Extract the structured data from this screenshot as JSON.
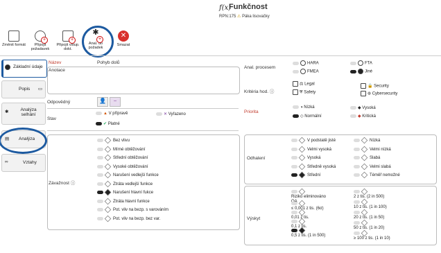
{
  "header": {
    "fx": "f(x)",
    "title": "Funkčnost",
    "rpn": "RPN:175",
    "warning": "Páka lisovačky"
  },
  "toolbar": [
    {
      "label": "Změnit formát",
      "icon": "format-icon"
    },
    {
      "label": "Připojit požadavek",
      "icon": "add-requirement-icon"
    },
    {
      "label": "Připojit vstup. dokt.",
      "icon": "add-document-icon"
    },
    {
      "label": "Anal. do požadek",
      "icon": "analysis-icon"
    },
    {
      "label": "Smazat",
      "icon": "delete-icon"
    }
  ],
  "sidebar": {
    "items": [
      {
        "label": "Základní údaje"
      },
      {
        "label": "Popis"
      },
      {
        "label": "Analýza selhání"
      },
      {
        "label": "Analýza"
      },
      {
        "label": "Vztahy"
      }
    ]
  },
  "form": {
    "name_label": "Název",
    "name_value": "Pohyb dolů",
    "annotation_label": "Anotace",
    "responsible_label": "Odpovědný",
    "state_label": "Stav",
    "state_options": [
      "V přípravě",
      "Vyřazeno",
      "Platné"
    ],
    "severity_label": "Závažnost",
    "severity_options": [
      "Bez vlivu",
      "Mírné obtěžování",
      "Střední obtěžování",
      "Vysoké obtěžování",
      "Narušení vedlejší funkce",
      "Ztráta vedlejší funkce",
      "Narušení hlavní fukce",
      "Ztráta hlavní funkce",
      "Pot. vliv na bezp. s varováním",
      "Pot. vliv na bezp. bez var."
    ]
  },
  "right": {
    "anal_proc_label": "Anal. procesem",
    "anal_proc_options": [
      "HARA",
      "FTA",
      "FMEA",
      "Jiné"
    ],
    "criteria_label": "Kritéria hod.",
    "criteria_options": [
      "Legal",
      "Security",
      "Safety",
      "Cybersecurity"
    ],
    "priority_label": "Priorita",
    "priority_options": [
      "Nízká",
      "Vysoká",
      "Normální",
      "Kritická"
    ],
    "detect_label": "Odhalení",
    "detect_options": [
      "V podstatě jisté",
      "Nízká",
      "Velmi vysoká",
      "Velmi nízká",
      "Vysoká",
      "Slabá",
      "Středně vysoká",
      "Velmi slabá",
      "Střední",
      "Téměř nemožné"
    ],
    "occurrence_label": "Výskyt",
    "occurrence_left": [
      "Riziko eliminováno QA",
      "≤ 0,001 z tis. (6σ)",
      "0,01 z tis.",
      "0,1 z tis.",
      "0,5 z tis. (1 in 500)"
    ],
    "occurrence_right": [
      "2 z tis. (2 in 500)",
      "10 z tis. (1 in 100)",
      "20 z tis. (1 in 50)",
      "50 z tis. (1 in 20)",
      "≥ 100 z tis. (1 in 10)"
    ]
  }
}
